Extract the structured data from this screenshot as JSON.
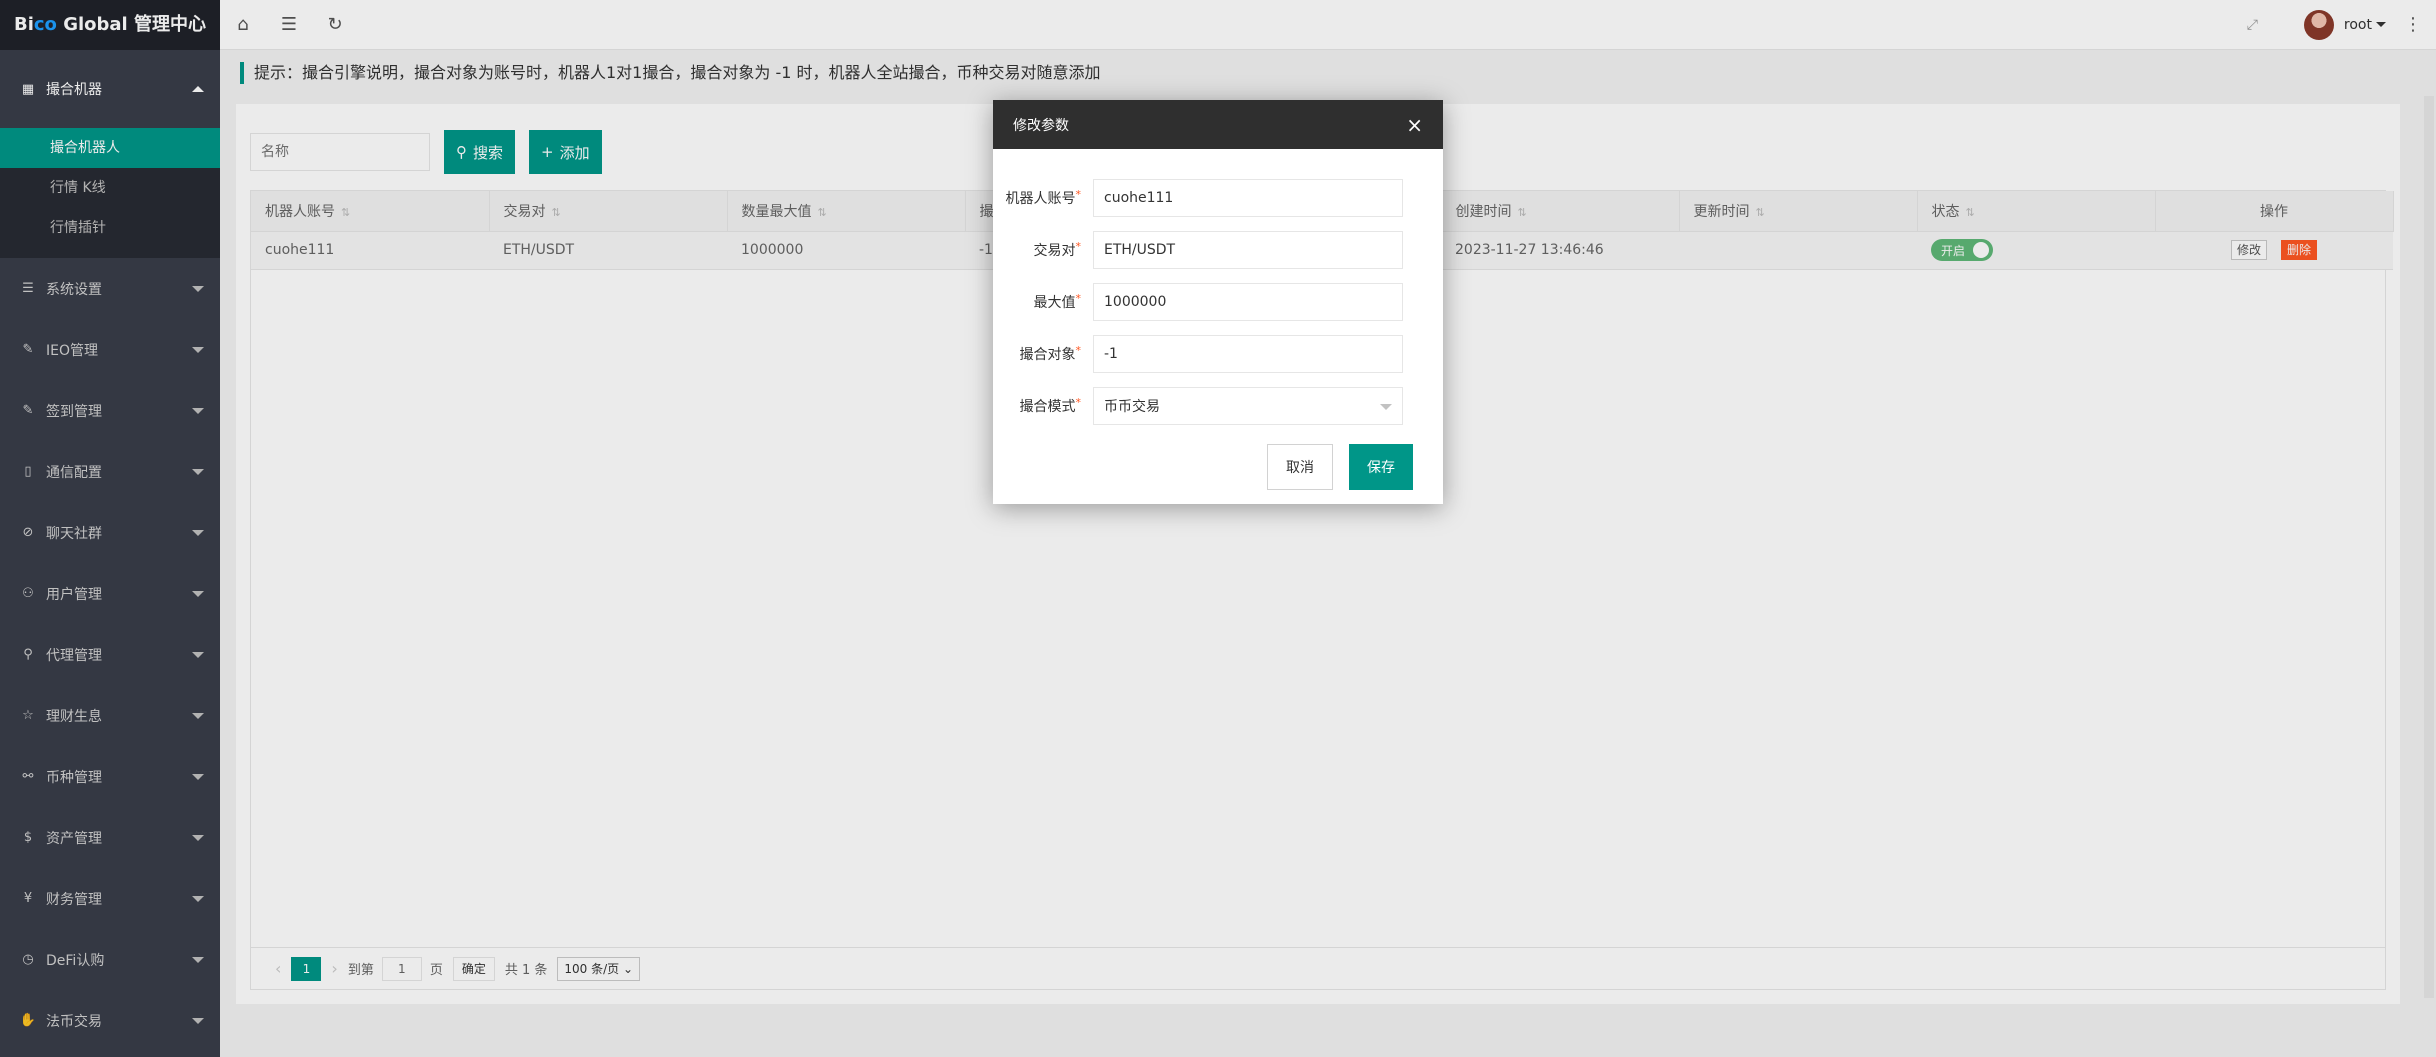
{
  "brand": {
    "part1": "Bi",
    "part2": "co",
    "part3": " Global 管理中心"
  },
  "header": {
    "user": "root"
  },
  "sidebar": {
    "open_group": "撮合机器",
    "sub_items": [
      "撮合机器人",
      "行情 K线",
      "行情插针"
    ],
    "groups": [
      "系统设置",
      "IEO管理",
      "签到管理",
      "通信配置",
      "聊天社群",
      "用户管理",
      "代理管理",
      "理财生息",
      "币种管理",
      "资产管理",
      "财务管理",
      "DeFi认购",
      "法币交易"
    ]
  },
  "notice": "提示：撮合引擎说明，撮合对象为账号时，机器人1对1撮合，撮合对象为 -1 时，机器人全站撮合，币种交易对随意添加",
  "toolbar": {
    "search_placeholder": "名称",
    "search_label": "搜索",
    "add_label": "添加"
  },
  "table": {
    "headers": [
      "机器人账号",
      "交易对",
      "数量最大值",
      "撮",
      "",
      "创建时间",
      "更新时间",
      "状态",
      "操作"
    ],
    "row": {
      "account": "cuohe111",
      "pair": "ETH/USDT",
      "max": "1000000",
      "target": "-1",
      "created": "2023-11-27 13:46:46",
      "updated": "",
      "status": "开启",
      "edit": "修改",
      "delete": "删除"
    }
  },
  "pager": {
    "page": "1",
    "goto": "到第",
    "goto_value": "1",
    "page_unit": "页",
    "confirm": "确定",
    "total": "共 1 条",
    "per_page": "100 条/页"
  },
  "modal": {
    "title": "修改参数",
    "fields": [
      {
        "label": "机器人账号",
        "value": "cuohe111"
      },
      {
        "label": "交易对",
        "value": "ETH/USDT"
      },
      {
        "label": "最大值",
        "value": "1000000"
      },
      {
        "label": "撮合对象",
        "value": "-1"
      },
      {
        "label": "撮合模式",
        "value": "币币交易"
      }
    ],
    "cancel": "取消",
    "save": "保存"
  }
}
